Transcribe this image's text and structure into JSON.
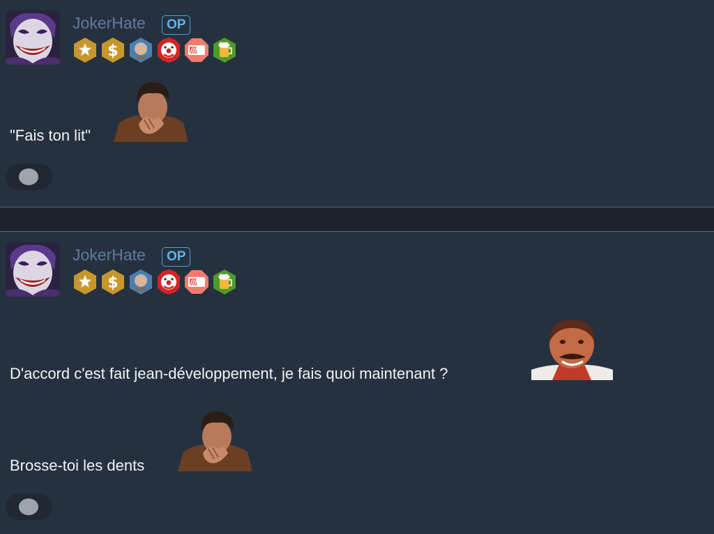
{
  "posts": [
    {
      "username": "JokerHate",
      "op_badge": "OP",
      "avatar": "joker-avatar",
      "badges": [
        "star-badge",
        "dollar-badge",
        "portrait-badge",
        "clown-badge",
        "card-badge",
        "beer-badge"
      ],
      "lines": [
        {
          "text": "\"Fais ton lit\"",
          "sticker": "laughing-man-sticker"
        }
      ]
    },
    {
      "username": "JokerHate",
      "op_badge": "OP",
      "avatar": "joker-avatar",
      "badges": [
        "star-badge",
        "dollar-badge",
        "portrait-badge",
        "clown-badge",
        "card-badge",
        "beer-badge"
      ],
      "lines": [
        {
          "text": "D'accord c'est fait jean-développement, je fais quoi maintenant ?",
          "sticker": "risitas-sticker"
        },
        {
          "text": "Brosse-toi les dents",
          "sticker": "laughing-man-sticker"
        }
      ]
    }
  ],
  "colors": {
    "background": "#263140",
    "separator": "#1d232c",
    "username": "#5f7a9a",
    "op_accent": "#5cb6ea",
    "text": "#f2f4f6"
  }
}
